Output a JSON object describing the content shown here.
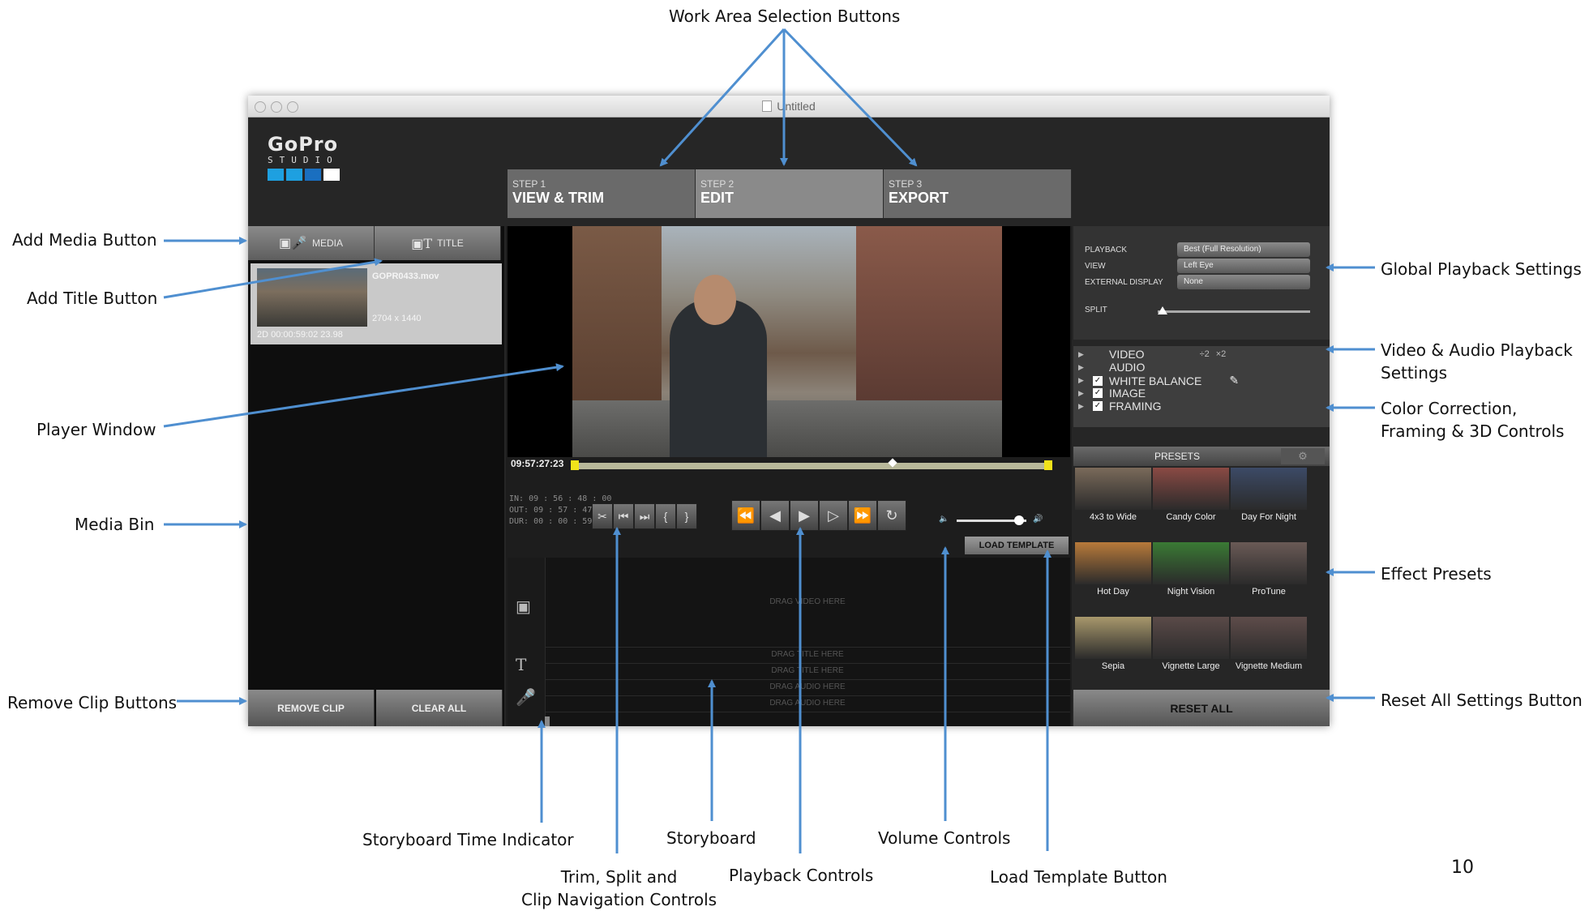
{
  "callouts": {
    "work_area": "Work Area Selection Buttons",
    "add_media": "Add Media Button",
    "add_title": "Add Title Button",
    "player_window": "Player Window",
    "media_bin": "Media Bin",
    "remove_clip": "Remove Clip Buttons",
    "global_playback": "Global Playback Settings",
    "va_playback_1": "Video & Audio Playback",
    "va_playback_2": "Settings",
    "color_corr_1": "Color Correction,",
    "color_corr_2": "Framing & 3D Controls",
    "effect_presets": "Effect Presets",
    "reset_all": "Reset All Settings Button",
    "storyboard_time": "Storyboard Time Indicator",
    "storyboard": "Storyboard",
    "volume": "Volume Controls",
    "trim_1": "Trim, Split and",
    "trim_2": "Clip Navigation Controls",
    "playback_controls": "Playback Controls",
    "load_template": "Load Template Button"
  },
  "page_number": "10",
  "window": {
    "title": "Untitled",
    "logo_word": "GoPro",
    "logo_sub": "STUDIO",
    "logo_colors": [
      "#1ea0e0",
      "#1ea0e0",
      "#1a6fc0",
      "#ffffff"
    ]
  },
  "steps": [
    {
      "num": "STEP 1",
      "name": "VIEW & TRIM"
    },
    {
      "num": "STEP 2",
      "name": "EDIT"
    },
    {
      "num": "STEP 3",
      "name": "EXPORT"
    }
  ],
  "media": {
    "media_label": "MEDIA",
    "title_label": "TITLE",
    "clip": {
      "name": "GOPR0433.mov",
      "resolution": "2704 x 1440",
      "meta": "2D      00:00:59:02  23.98"
    },
    "remove_clip": "REMOVE CLIP",
    "clear_all": "CLEAR ALL"
  },
  "player": {
    "timecode": "09:57:27:23",
    "in": "IN: 09 : 56 : 48 : 00",
    "out": "OUT: 09 : 57 : 47 : 01",
    "dur": "DUR: 00 : 00 : 59 : 01",
    "load_template": "LOAD TEMPLATE",
    "playhead_fraction": 0.67,
    "volume_fraction": 0.9
  },
  "storyboard": {
    "video": "DRAG VIDEO HERE",
    "title1": "DRAG TITLE HERE",
    "title2": "DRAG TITLE HERE",
    "audio1": "DRAG AUDIO HERE",
    "audio2": "DRAG AUDIO HERE"
  },
  "settings": {
    "playback_label": "PLAYBACK",
    "playback_value": "Best (Full Resolution)",
    "view_label": "VIEW",
    "view_value": "Left Eye",
    "ext_label": "EXTERNAL DISPLAY",
    "ext_value": "None",
    "split_label": "SPLIT"
  },
  "va": {
    "video": "VIDEO",
    "speed1": "÷2",
    "speed2": "×2",
    "audio": "AUDIO",
    "white_balance": "WHITE BALANCE",
    "image": "IMAGE",
    "framing": "FRAMING"
  },
  "presets": {
    "header": "PRESETS",
    "items": [
      {
        "label": "4x3 to Wide",
        "color": "#7a6a5a"
      },
      {
        "label": "Candy Color",
        "color": "#8a4a44"
      },
      {
        "label": "Day For Night",
        "color": "#3c4a66"
      },
      {
        "label": "Hot Day",
        "color": "#b87a3a"
      },
      {
        "label": "Night Vision",
        "color": "#3a7a34"
      },
      {
        "label": "ProTune",
        "color": "#6a5a56"
      },
      {
        "label": "Sepia",
        "color": "#a8986c"
      },
      {
        "label": "Vignette Large",
        "color": "#5a4a48"
      },
      {
        "label": "Vignette Medium",
        "color": "#5e4c4a"
      }
    ],
    "reset_all": "RESET ALL"
  }
}
